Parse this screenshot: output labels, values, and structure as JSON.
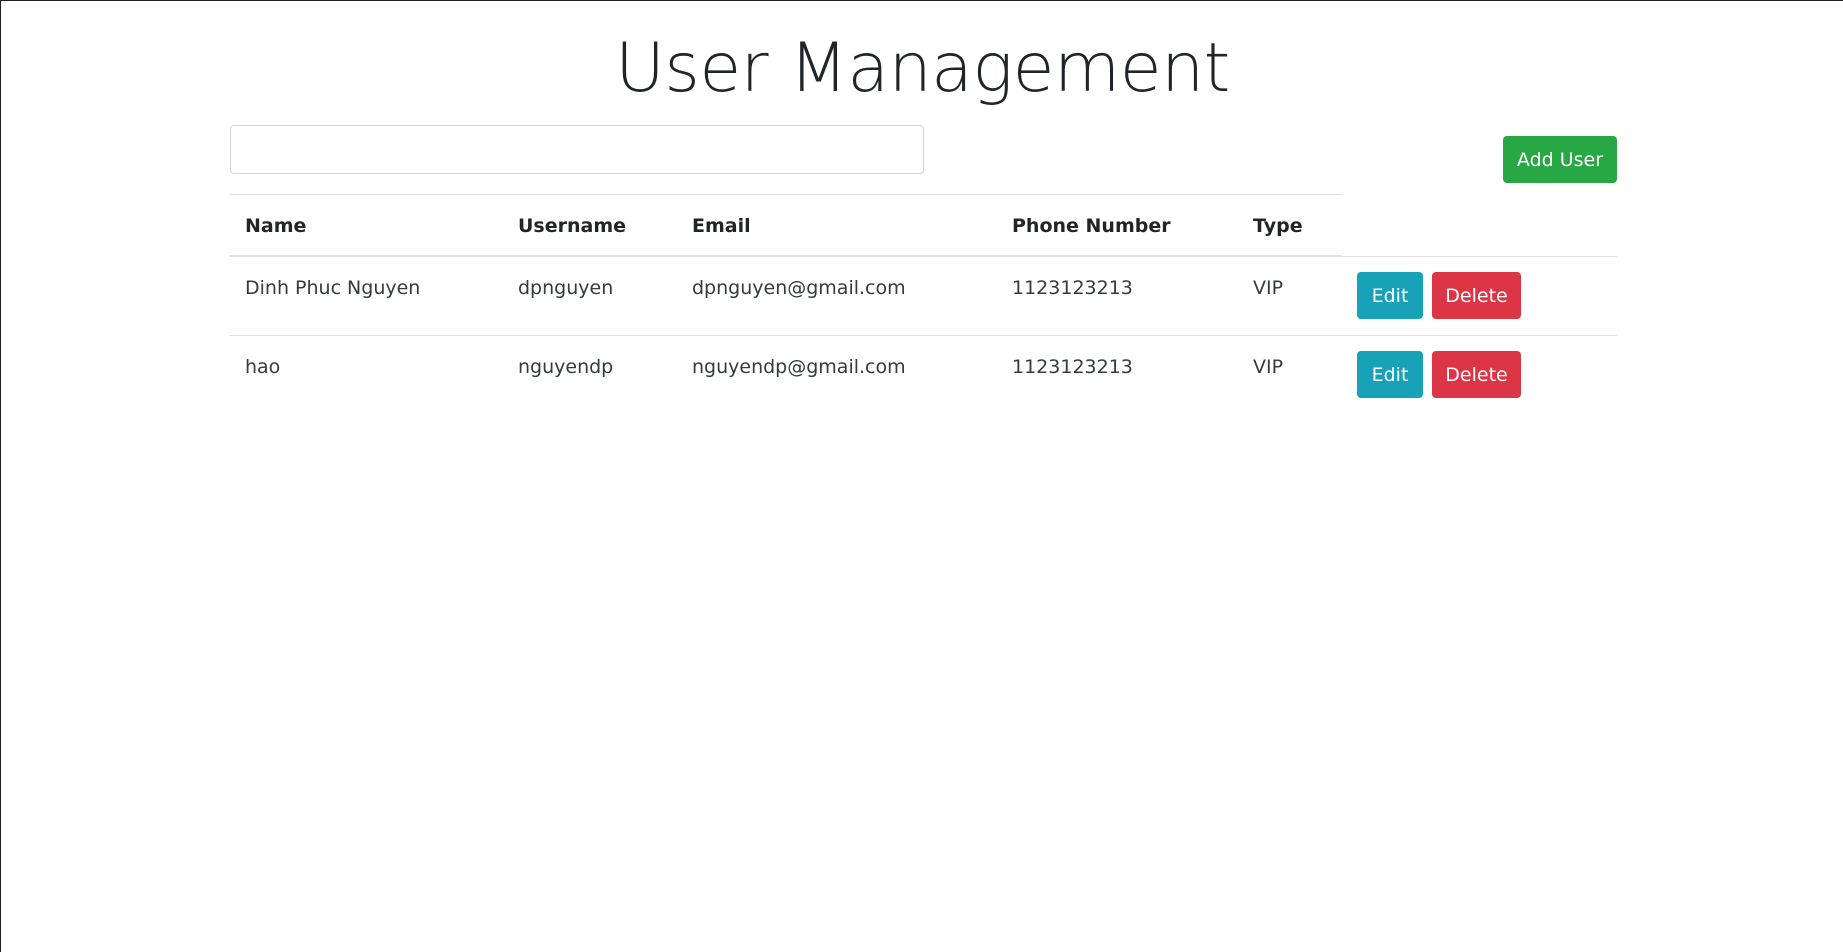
{
  "page": {
    "title": "User Management"
  },
  "search": {
    "value": "",
    "placeholder": ""
  },
  "toolbar": {
    "add_user_label": "Add User",
    "add_user_color": "#28a745"
  },
  "table": {
    "headers": {
      "name": "Name",
      "username": "Username",
      "email": "Email",
      "phone": "Phone Number",
      "type": "Type"
    },
    "rows": [
      {
        "name": "Dinh Phuc Nguyen",
        "username": "dpnguyen",
        "email": "dpnguyen@gmail.com",
        "phone": "1123123213",
        "type": "VIP",
        "edit_label": "Edit",
        "delete_label": "Delete"
      },
      {
        "name": "hao",
        "username": "nguyendp",
        "email": "nguyendp@gmail.com",
        "phone": "1123123213",
        "type": "VIP",
        "edit_label": "Edit",
        "delete_label": "Delete"
      }
    ]
  },
  "colors": {
    "edit": "#17a2b8",
    "delete": "#dc3545"
  }
}
